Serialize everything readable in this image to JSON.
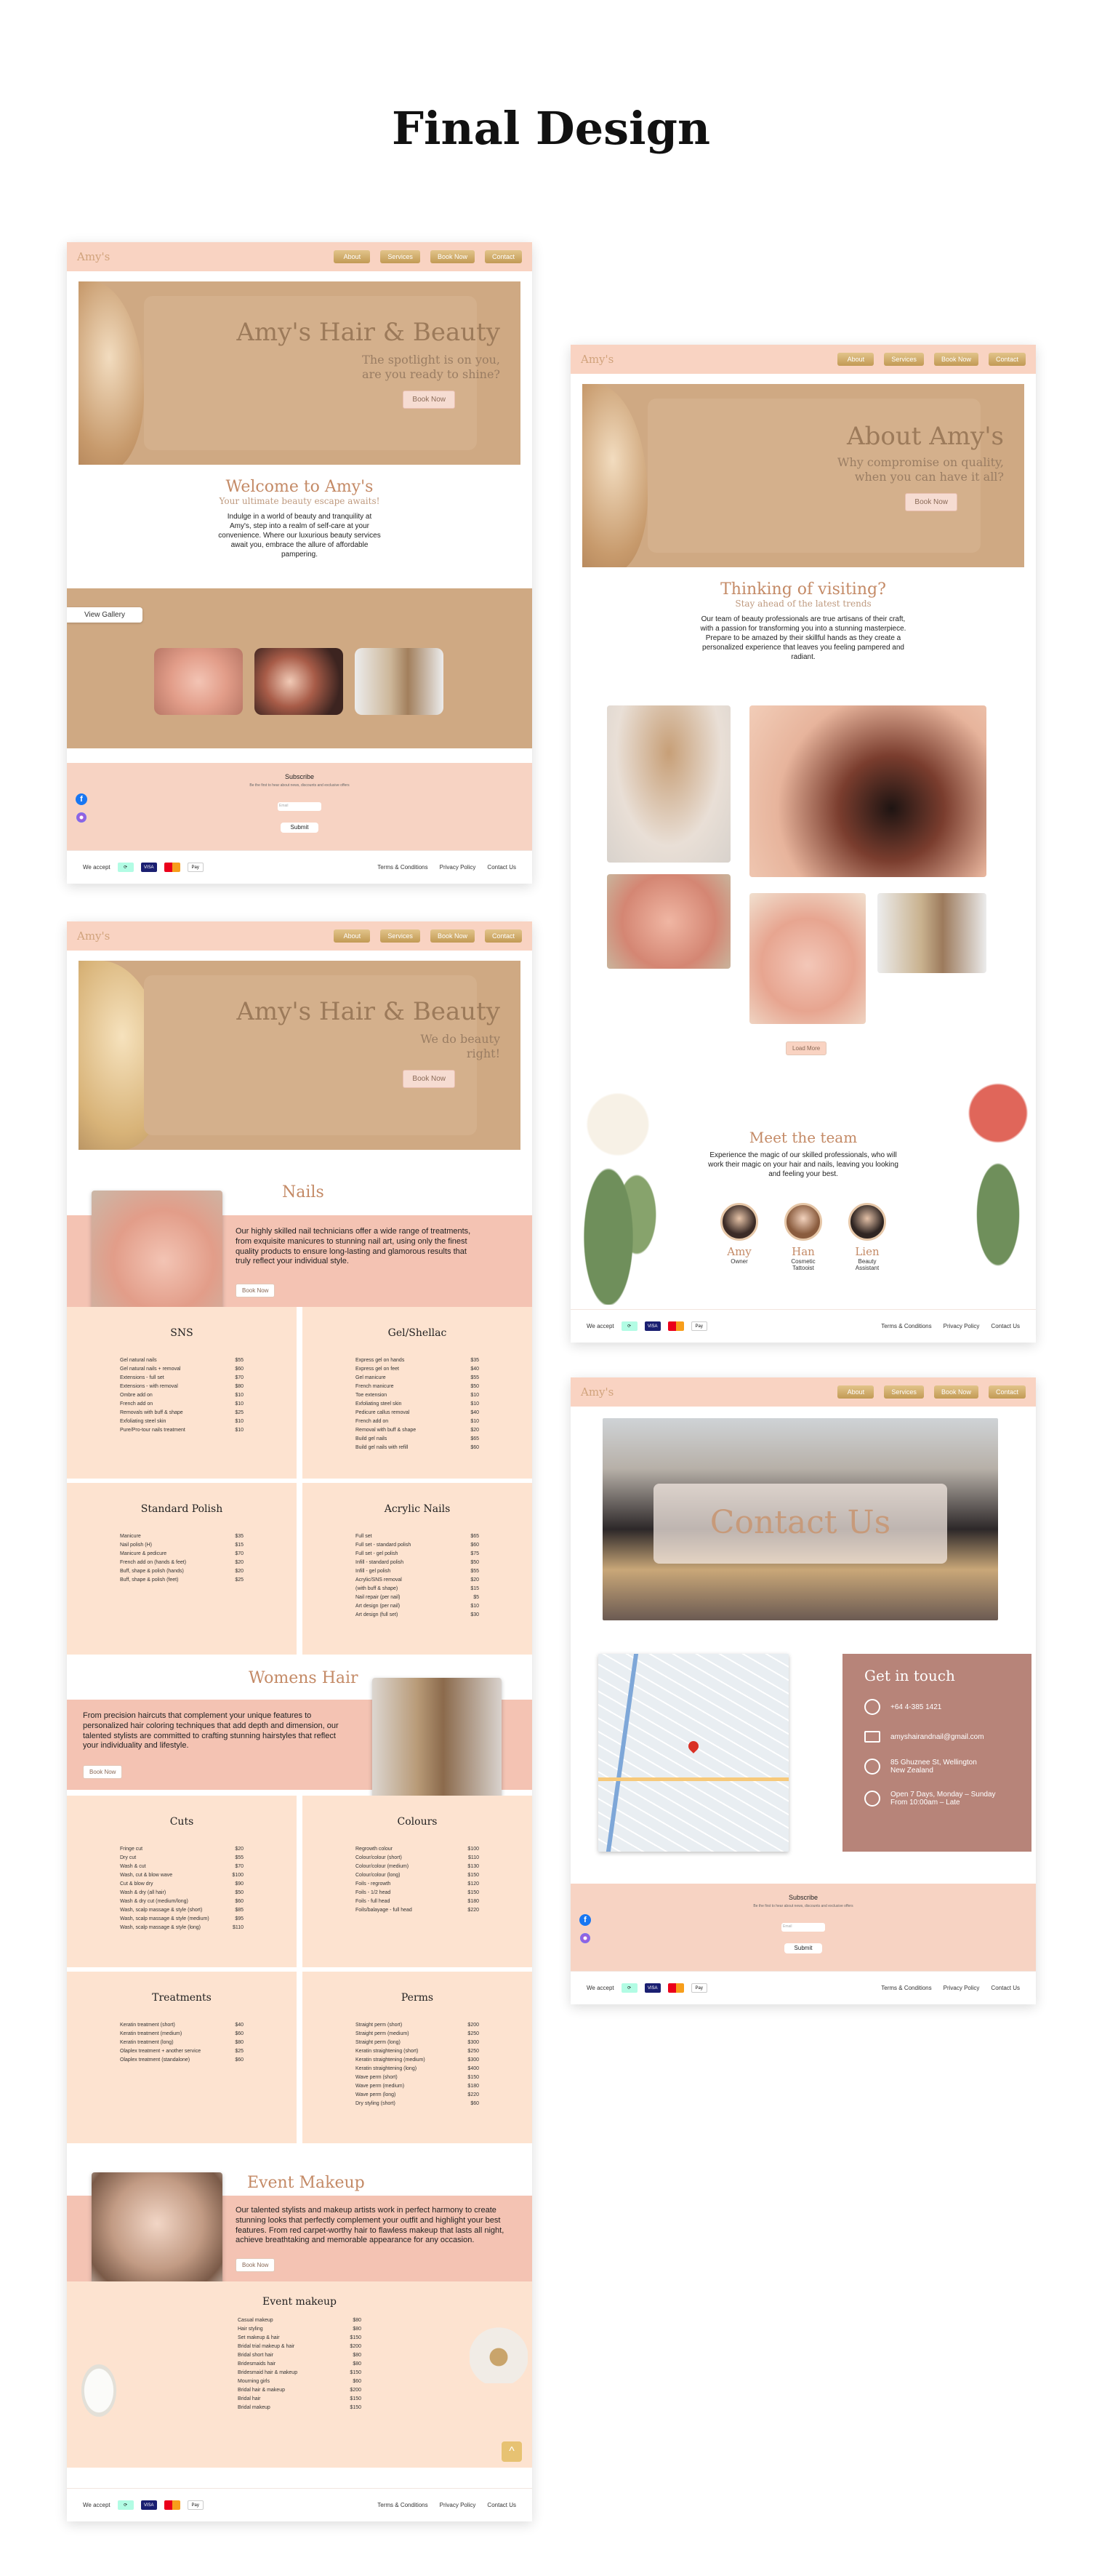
{
  "heading": "Final Design",
  "brand": "Amy's",
  "nav": {
    "about": "About",
    "services": "Services",
    "book": "Book Now",
    "contact": "Contact"
  },
  "home": {
    "hero_title": "Amy's Hair & Beauty",
    "hero_sub1": "The spotlight is on you,",
    "hero_sub2": "are you ready to shine?",
    "hero_btn": "Book Now",
    "welcome_title": "Welcome to Amy's",
    "welcome_sub": "Your ultimate beauty escape awaits!",
    "welcome_body": "Indulge in a world of beauty and tranquility at Amy's, step into a realm of self-care at your convenience. Where our luxurious beauty services await you, embrace the allure of affordable pampering.",
    "gallery_btn": "View Gallery"
  },
  "subscribe": {
    "title": "Subscribe",
    "text": "Be the first to hear about news, discounts and exclusive offers",
    "placeholder": "Email",
    "button": "Submit"
  },
  "footer": {
    "accept": "We accept",
    "terms": "Terms & Conditions",
    "privacy": "Privacy Policy",
    "contact": "Contact Us",
    "card_visa": "VISA",
    "card_amex": "AMEX",
    "card_applepay": "Pay"
  },
  "about": {
    "hero_title": "About Amy's",
    "hero_sub1": "Why compromise on quality,",
    "hero_sub2": "when you can have it all?",
    "hero_btn": "Book Now",
    "visit_title": "Thinking of visiting?",
    "visit_sub": "Stay ahead of the latest trends",
    "visit_body": "Our team of beauty professionals are true artisans of their craft, with a passion for transforming you into a stunning masterpiece. Prepare to be amazed by their skillful hands as they create a personalized experience that leaves you feeling pampered and radiant.",
    "load_more": "Load More",
    "team_title": "Meet the team",
    "team_body": "Experience the magic of our skilled professionals, who will work their magic on your hair and nails, leaving you looking and feeling your best.",
    "team": [
      {
        "name": "Amy",
        "role": "Owner"
      },
      {
        "name": "Han",
        "role": "Cosmetic Tattooist"
      },
      {
        "name": "Lien",
        "role": "Beauty Assistant"
      }
    ]
  },
  "services": {
    "hero_title": "Amy's Hair & Beauty",
    "hero_sub1": "We do beauty",
    "hero_sub2": "right!",
    "hero_btn": "Book Now",
    "nails_title": "Nails",
    "nails_body": "Our highly skilled nail technicians offer a wide range of treatments, from exquisite manicures to stunning nail art, using only the finest quality products to ensure long-lasting and glamorous results that truly reflect your individual style.",
    "nails_btn": "Book Now",
    "womens_title": "Womens Hair",
    "womens_body": "From precision haircuts that complement your unique features to personalized hair coloring techniques that add depth and dimension, our talented stylists are committed to crafting stunning hairstyles that reflect your individuality and lifestyle.",
    "womens_btn": "Book Now",
    "makeup_title": "Event Makeup",
    "makeup_body": "Our talented stylists and makeup artists work in perfect harmony to create stunning looks that perfectly complement your outfit and highlight your best features. From red carpet-worthy hair to flawless makeup that lasts all night, achieve breathtaking and memorable appearance for any occasion.",
    "makeup_btn": "Book Now",
    "menus": [
      {
        "title": "SNS",
        "items": [
          [
            "Gel natural nails",
            "$55"
          ],
          [
            "Gel natural nails + removal",
            "$60"
          ],
          [
            "Extensions - full set",
            "$70"
          ],
          [
            "Extensions - with removal",
            "$80"
          ],
          [
            "Ombre add on",
            "$10"
          ],
          [
            "French add on",
            "$10"
          ],
          [
            "Removals with buff & shape",
            "$25"
          ],
          [
            "Exfoliating steel skin",
            "$10"
          ],
          [
            "Pure/Pro-tour nails treatment",
            "$10"
          ]
        ]
      },
      {
        "title": "Gel/Shellac",
        "items": [
          [
            "Express gel on hands",
            "$35"
          ],
          [
            "Express gel on feet",
            "$40"
          ],
          [
            "Gel manicure",
            "$55"
          ],
          [
            "French manicure",
            "$50"
          ],
          [
            "Toe extension",
            "$10"
          ],
          [
            "Exfoliating steel skin",
            "$10"
          ],
          [
            "Pedicure callus removal",
            "$40"
          ],
          [
            "French add on",
            "$10"
          ],
          [
            "Removal with buff & shape",
            "$20"
          ],
          [
            "Build gel nails",
            "$65"
          ],
          [
            "Build gel nails with refill",
            "$60"
          ]
        ]
      },
      {
        "title": "Standard Polish",
        "items": [
          [
            "Manicure",
            "$35"
          ],
          [
            "Nail polish (H)",
            "$15"
          ],
          [
            "Manicure & pedicure",
            "$70"
          ],
          [
            "French add on (hands & feet)",
            "$20"
          ],
          [
            "Buff, shape & polish (hands)",
            "$20"
          ],
          [
            "Buff, shape & polish (feet)",
            "$25"
          ]
        ]
      },
      {
        "title": "Acrylic Nails",
        "items": [
          [
            "Full set",
            "$65"
          ],
          [
            "Full set - standard polish",
            "$60"
          ],
          [
            "Full set - gel polish",
            "$75"
          ],
          [
            "Infill - standard polish",
            "$50"
          ],
          [
            "Infill - gel polish",
            "$55"
          ],
          [
            "Acrylic/SNS removal",
            "$20"
          ],
          [
            "(with buff & shape)",
            "$15"
          ],
          [
            "Nail repair (per nail)",
            "$5"
          ],
          [
            "Art design (per nail)",
            "$10"
          ],
          [
            "Art design (full set)",
            "$30"
          ]
        ]
      },
      {
        "title": "Cuts",
        "items": [
          [
            "Fringe cut",
            "$20"
          ],
          [
            "Dry cut",
            "$55"
          ],
          [
            "Wash & cut",
            "$70"
          ],
          [
            "Wash, cut & blow wave",
            "$100"
          ],
          [
            "Cut & blow dry",
            "$90"
          ],
          [
            "Wash & dry (all hair)",
            "$50"
          ],
          [
            "Wash & dry cut (medium/long)",
            "$60"
          ],
          [
            "Wash, scalp massage & style (short)",
            "$85"
          ],
          [
            "Wash, scalp massage & style (medium)",
            "$95"
          ],
          [
            "Wash, scalp massage & style (long)",
            "$110"
          ]
        ]
      },
      {
        "title": "Colours",
        "items": [
          [
            "Regrowth colour",
            "$100"
          ],
          [
            "Colour/colour (short)",
            "$110"
          ],
          [
            "Colour/colour (medium)",
            "$130"
          ],
          [
            "Colour/colour (long)",
            "$150"
          ],
          [
            "Foils - regrowth",
            "$120"
          ],
          [
            "Foils - 1/2 head",
            "$150"
          ],
          [
            "Foils - full head",
            "$180"
          ],
          [
            "Foils/balayage - full head",
            "$220"
          ]
        ]
      },
      {
        "title": "Treatments",
        "items": [
          [
            "Keratin treatment (short)",
            "$40"
          ],
          [
            "Keratin treatment (medium)",
            "$60"
          ],
          [
            "Keratin treatment (long)",
            "$80"
          ],
          [
            "Olaplex treatment + another service",
            "$25"
          ],
          [
            "Olaplex treatment (standalone)",
            "$60"
          ]
        ]
      },
      {
        "title": "Perms",
        "items": [
          [
            "Straight perm (short)",
            "$200"
          ],
          [
            "Straight perm (medium)",
            "$250"
          ],
          [
            "Straight perm (long)",
            "$300"
          ],
          [
            "Keratin straightening (short)",
            "$250"
          ],
          [
            "Keratin straightening (medium)",
            "$300"
          ],
          [
            "Keratin straightening (long)",
            "$400"
          ],
          [
            "Wave perm (short)",
            "$150"
          ],
          [
            "Wave perm (medium)",
            "$180"
          ],
          [
            "Wave perm (long)",
            "$220"
          ],
          [
            "Dry styling (short)",
            "$60"
          ]
        ]
      },
      {
        "title": "Event makeup",
        "items": [
          [
            "Casual makeup",
            "$80"
          ],
          [
            "Hair styling",
            "$80"
          ],
          [
            "Set makeup & hair",
            "$150"
          ],
          [
            "Bridal trial makeup & hair",
            "$200"
          ],
          [
            "Bridal short hair",
            "$80"
          ],
          [
            "Bridesmaids hair",
            "$80"
          ],
          [
            "Bridesmaid hair & makeup",
            "$150"
          ],
          [
            "Mourning girls",
            "$60"
          ],
          [
            "Bridal hair & makeup",
            "$200"
          ],
          [
            "Bridal hair",
            "$150"
          ],
          [
            "Bridal makeup",
            "$150"
          ]
        ]
      }
    ]
  },
  "contact": {
    "hero_title": "Contact Us",
    "card_title": "Get in touch",
    "phone": "+64 4-385 1421",
    "email": "amyshairandnail@gmail.com",
    "address1": "85 Ghuznee St, Wellington",
    "address2": "New Zealand",
    "hours1": "Open 7 Days, Monday – Sunday",
    "hours2": "From 10:00am – Late"
  },
  "colors": {
    "nav": "#f9d3c2",
    "accent": "#c48a66",
    "gold": "#c29a55",
    "panel": "#fde3d0",
    "card": "#b78479"
  }
}
